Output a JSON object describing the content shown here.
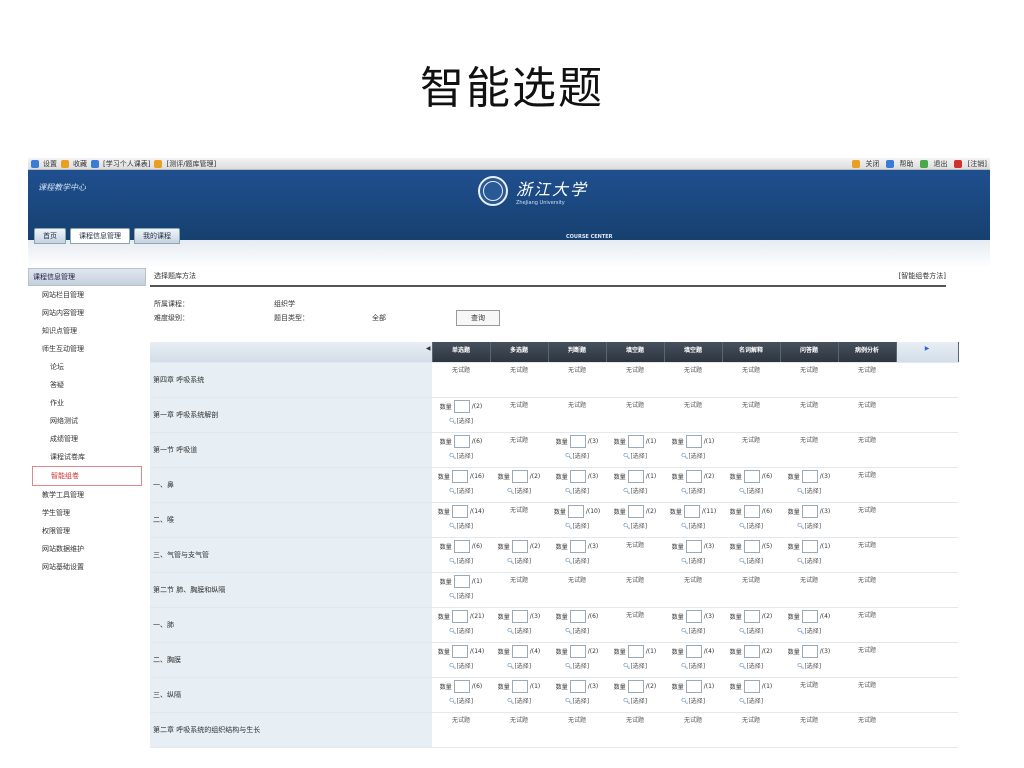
{
  "slide_title": "智能选题",
  "browser_bar": {
    "left_items": [
      "设置",
      "收藏",
      "[学习个人课表]",
      "[测评/题库管理]"
    ],
    "right_items": [
      "关闭",
      "帮助",
      "退出",
      "[注销]"
    ]
  },
  "banner": {
    "site_name": "课程教学中心",
    "university_cn": "浙江大学",
    "university_en": "ZheJiang University",
    "center_label": "COURSE CENTER",
    "tabs": [
      "首页",
      "课程信息管理",
      "我的课程"
    ]
  },
  "sidebar": {
    "header": "课程信息管理",
    "items": [
      {
        "label": "网站栏目管理",
        "level": 1
      },
      {
        "label": "网站内容管理",
        "level": 1
      },
      {
        "label": "知识点管理",
        "level": 1
      },
      {
        "label": "师生互动管理",
        "level": 1
      },
      {
        "label": "论坛",
        "level": 2
      },
      {
        "label": "答疑",
        "level": 2
      },
      {
        "label": "作业",
        "level": 2
      },
      {
        "label": "网络测试",
        "level": 2
      },
      {
        "label": "成绩管理",
        "level": 2
      },
      {
        "label": "课程试卷库",
        "level": 2
      },
      {
        "label": "智能组卷",
        "level": 2,
        "active": true
      },
      {
        "label": "教学工具管理",
        "level": 1
      },
      {
        "label": "学生管理",
        "level": 1
      },
      {
        "label": "权限管理",
        "level": 1
      },
      {
        "label": "网站数据维护",
        "level": 1
      },
      {
        "label": "网站基础设置",
        "level": 1
      }
    ]
  },
  "main": {
    "breadcrumb": "选择题库方法",
    "right_link": "[智能组卷方法]",
    "course_label": "所属课程：",
    "course_value": "组织学",
    "level_label": "难度级别：",
    "type_label": "题目类型：",
    "type_value": "全部",
    "query_button": "查询"
  },
  "grid": {
    "columns": [
      "单选题",
      "多选题",
      "判断题",
      "填空题",
      "填空题",
      "名词解释",
      "问答题",
      "病例分析"
    ],
    "rows": [
      {
        "name": "第四章 呼吸系统",
        "cells": [
          "无试题",
          "无试题",
          "无试题",
          "无试题",
          "无试题",
          "无试题",
          "无试题",
          "无试题"
        ]
      },
      {
        "name": "第一章 呼吸系统解剖",
        "cells": [
          "/(2)",
          "无试题",
          "无试题",
          "无试题",
          "无试题",
          "无试题",
          "无试题",
          "无试题"
        ]
      },
      {
        "name": "第一节 呼吸道",
        "cells": [
          "/(6)",
          "无试题",
          "/(3)",
          "/(1)",
          "/(1)",
          "无试题",
          "无试题",
          "无试题"
        ]
      },
      {
        "name": "一、鼻",
        "cells": [
          "/(16)",
          "/(2)",
          "/(3)",
          "/(1)",
          "/(2)",
          "/(6)",
          "/(3)",
          "无试题"
        ]
      },
      {
        "name": "二、喉",
        "cells": [
          "/(14)",
          "无试题",
          "/(10)",
          "/(2)",
          "/(11)",
          "/(6)",
          "/(3)",
          "无试题"
        ]
      },
      {
        "name": "三、气管与支气管",
        "cells": [
          "/(6)",
          "/(2)",
          "/(3)",
          "无试题",
          "/(3)",
          "/(5)",
          "/(1)",
          "无试题"
        ]
      },
      {
        "name": "第二节 肺、胸膜和纵隔",
        "cells": [
          "/(1)",
          "无试题",
          "无试题",
          "无试题",
          "无试题",
          "无试题",
          "无试题",
          "无试题"
        ]
      },
      {
        "name": "一、肺",
        "cells": [
          "/(21)",
          "/(3)",
          "/(6)",
          "无试题",
          "/(3)",
          "/(2)",
          "/(4)",
          "无试题"
        ]
      },
      {
        "name": "二、胸膜",
        "cells": [
          "/(14)",
          "/(4)",
          "/(2)",
          "/(1)",
          "/(4)",
          "/(2)",
          "/(3)",
          "无试题"
        ]
      },
      {
        "name": "三、纵隔",
        "cells": [
          "/(6)",
          "/(1)",
          "/(3)",
          "/(2)",
          "/(1)",
          "/(1)",
          "无试题",
          "无试题"
        ]
      },
      {
        "name": "第二章 呼吸系统的组织结构与生长",
        "cells": [
          "无试题",
          "无试题",
          "无试题",
          "无试题",
          "无试题",
          "无试题",
          "无试题",
          "无试题"
        ]
      }
    ],
    "count_label": "数量",
    "pick_label": "[选择]"
  }
}
